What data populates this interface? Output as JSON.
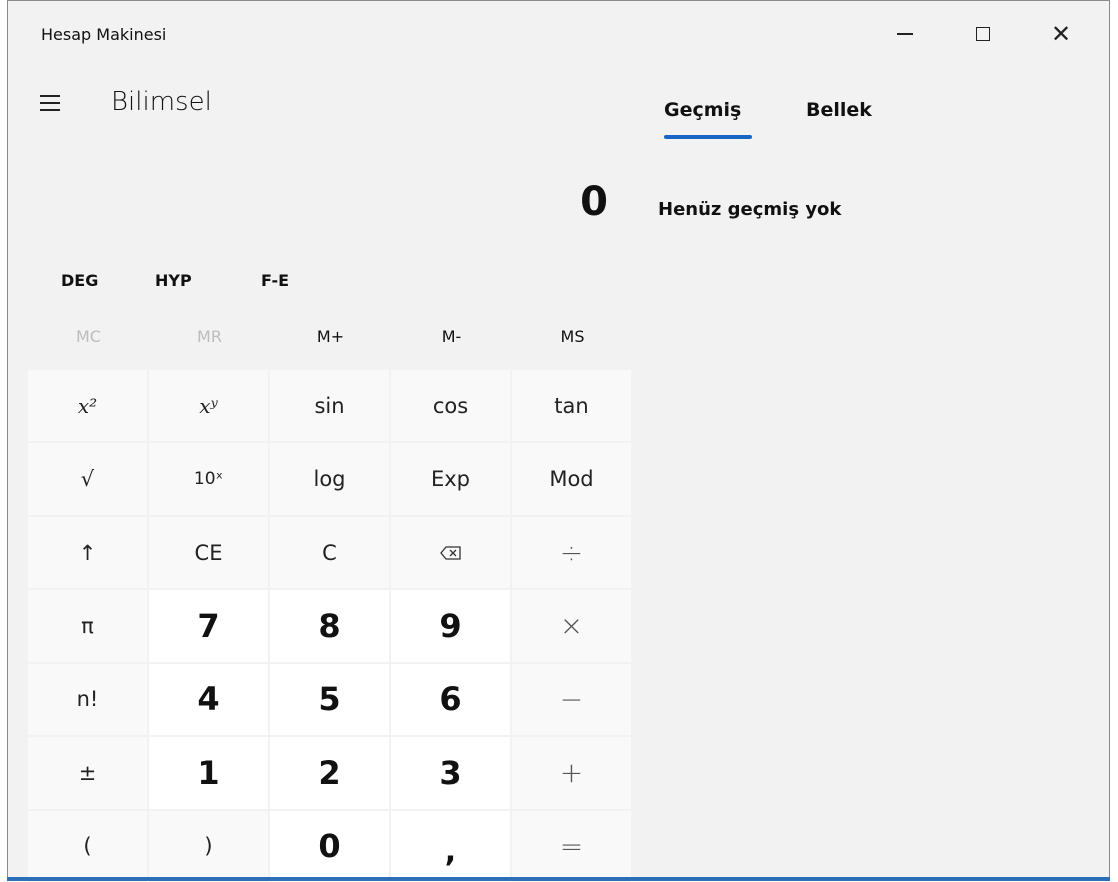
{
  "window": {
    "title": "Hesap Makinesi",
    "controls": {
      "minimize": "—",
      "maximize": "☐",
      "close": "✕"
    }
  },
  "header": {
    "mode_title": "Bilimsel"
  },
  "display": {
    "value": "0"
  },
  "side_panel": {
    "tabs": [
      {
        "label": "Geçmiş",
        "active": true
      },
      {
        "label": "Bellek",
        "active": false
      }
    ],
    "history_empty_text": "Henüz geçmiş yok"
  },
  "mode_buttons": [
    "DEG",
    "HYP",
    "F-E"
  ],
  "memory_buttons": [
    {
      "label": "MC",
      "enabled": false
    },
    {
      "label": "MR",
      "enabled": false
    },
    {
      "label": "M+",
      "enabled": true
    },
    {
      "label": "M-",
      "enabled": true
    },
    {
      "label": "MS",
      "enabled": true
    }
  ],
  "keypad": [
    [
      "x²",
      "xʸ",
      "sin",
      "cos",
      "tan"
    ],
    [
      "√",
      "10ˣ",
      "log",
      "Exp",
      "Mod"
    ],
    [
      "↑",
      "CE",
      "C",
      "backspace",
      "÷"
    ],
    [
      "π",
      "7",
      "8",
      "9",
      "×"
    ],
    [
      "n!",
      "4",
      "5",
      "6",
      "−"
    ],
    [
      "±",
      "1",
      "2",
      "3",
      "+"
    ],
    [
      "(",
      ")",
      "0",
      ",",
      "="
    ]
  ],
  "colors": {
    "window_bg": "#f2f2f2",
    "key_bg": "#f9f9f9",
    "number_key_bg": "#ffffff",
    "accent": "#1766c4",
    "disabled_text": "#bdbdbd"
  }
}
